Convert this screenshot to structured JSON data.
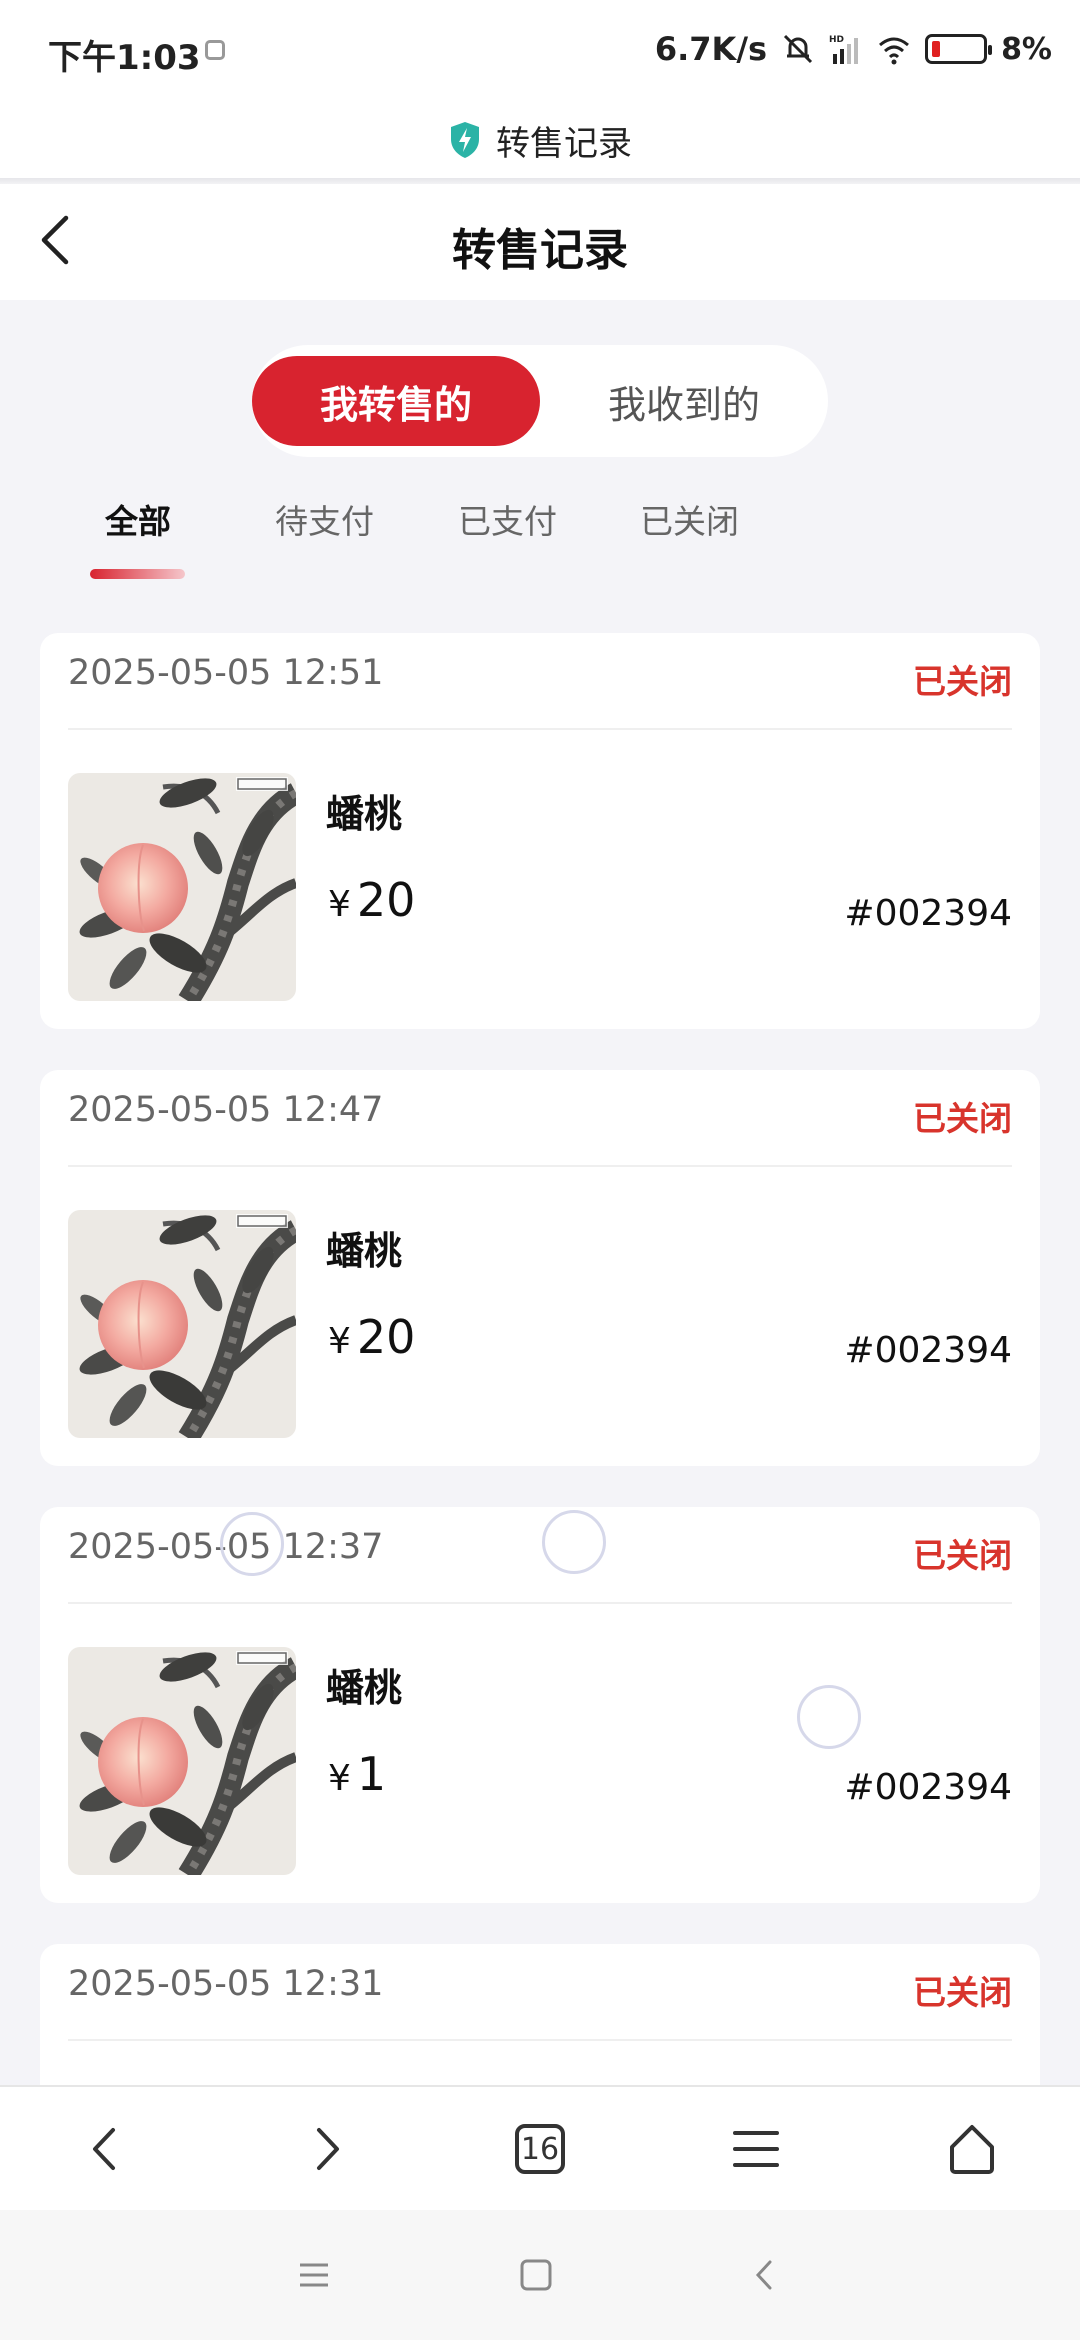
{
  "status_bar": {
    "time": "下午1:03",
    "network_speed": "6.7K/s",
    "network_type": "HD",
    "battery_percent": "8%"
  },
  "app_header": {
    "title": "转售记录",
    "icon": "shield-icon"
  },
  "page_header": {
    "title": "转售记录",
    "back_icon": "chevron-left-icon"
  },
  "segment": {
    "items": [
      "我转售的",
      "我收到的"
    ],
    "active": "我转售的"
  },
  "filter_tabs": {
    "items": [
      "全部",
      "待支付",
      "已支付",
      "已关闭"
    ],
    "active": "全部"
  },
  "orders": [
    {
      "time": "2025-05-05 12:51",
      "status": "已关闭",
      "name": "蟠桃",
      "currency": "¥",
      "price": "20",
      "serial": "#002394"
    },
    {
      "time": "2025-05-05 12:47",
      "status": "已关闭",
      "name": "蟠桃",
      "currency": "¥",
      "price": "20",
      "serial": "#002394"
    },
    {
      "time": "2025-05-05 12:37",
      "status": "已关闭",
      "name": "蟠桃",
      "currency": "¥",
      "price": "1",
      "serial": "#002394"
    },
    {
      "time": "2025-05-05 12:31",
      "status": "已关闭"
    }
  ],
  "browser_bar": {
    "tab_count": "16",
    "icons": [
      "back-icon",
      "forward-icon",
      "tabs-icon",
      "menu-icon",
      "home-icon"
    ]
  },
  "system_nav": {
    "icons": [
      "menu-icon",
      "home-icon",
      "back-icon"
    ]
  },
  "colors": {
    "accent": "#d8232f",
    "status_closed": "#d8342c",
    "background": "#f4f4f8"
  }
}
